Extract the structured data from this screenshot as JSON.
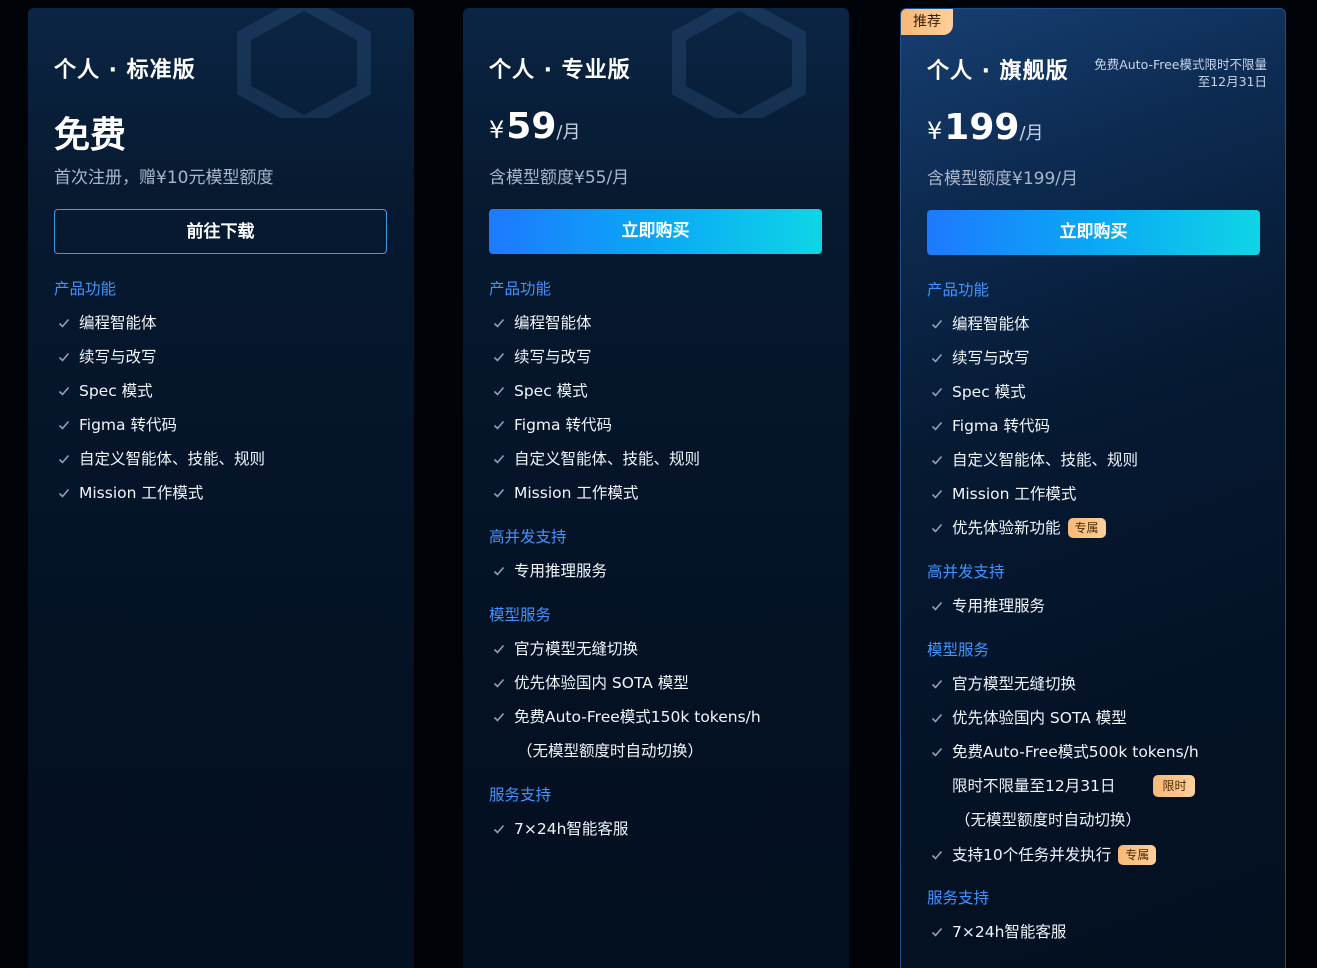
{
  "plans": [
    {
      "title": "个人 · 标准版",
      "price_text": "免费",
      "sub": "首次注册，赠¥10元模型额度",
      "button": "前往下载",
      "sections": [
        {
          "heading": "产品功能",
          "items": [
            "编程智能体",
            "续写与改写",
            "Spec 模式",
            "Figma 转代码",
            "自定义智能体、技能、规则",
            "Mission 工作模式"
          ]
        }
      ]
    },
    {
      "title": "个人 · 专业版",
      "currency": "¥",
      "price": "59",
      "period": "/月",
      "sub": "含模型额度¥55/月",
      "button": "立即购买",
      "sections": [
        {
          "heading": "产品功能",
          "items": [
            "编程智能体",
            "续写与改写",
            "Spec 模式",
            "Figma 转代码",
            "自定义智能体、技能、规则",
            "Mission 工作模式"
          ]
        },
        {
          "heading": "高并发支持",
          "items": [
            "专用推理服务"
          ]
        },
        {
          "heading": "模型服务",
          "items": [
            "官方模型无缝切换",
            "优先体验国内 SOTA 模型",
            "免费Auto-Free模式150k tokens/h"
          ],
          "note": "（无模型额度时自动切换）"
        },
        {
          "heading": "服务支持",
          "items": [
            "7×24h智能客服"
          ]
        }
      ]
    },
    {
      "title": "个人 · 旗舰版",
      "badge": "推荐",
      "promo_line1": "免费Auto-Free模式限时不限量",
      "promo_line2": "至12月31日",
      "currency": "¥",
      "price": "199",
      "period": "/月",
      "sub": "含模型额度¥199/月",
      "button": "立即购买",
      "sections": [
        {
          "heading": "产品功能",
          "items": [
            "编程智能体",
            "续写与改写",
            "Spec 模式",
            "Figma 转代码",
            "自定义智能体、技能、规则",
            "Mission 工作模式",
            "优先体验新功能"
          ],
          "tag_exclusive": "专属"
        },
        {
          "heading": "高并发支持",
          "items": [
            "专用推理服务"
          ]
        },
        {
          "heading": "模型服务",
          "items": [
            "官方模型无缝切换",
            "优先体验国内 SOTA 模型",
            "免费Auto-Free模式500k tokens/h"
          ],
          "limit_line": "限时不限量至12月31日",
          "tag_limited": "限时",
          "note": "（无模型额度时自动切换）",
          "extra_item": "支持10个任务并发执行",
          "tag_exclusive": "专属"
        },
        {
          "heading": "服务支持",
          "items": [
            "7×24h智能客服"
          ]
        }
      ]
    }
  ],
  "colors": {
    "accent_blue": "#3f94ff",
    "button_gradient_start": "#1e79ff",
    "button_gradient_end": "#0fd5e6",
    "tag_orange": "#f6b978",
    "check_gray": "#8fa0b8"
  },
  "icons": {
    "check": "check-icon",
    "hexagon": "hexagon-decoration"
  }
}
